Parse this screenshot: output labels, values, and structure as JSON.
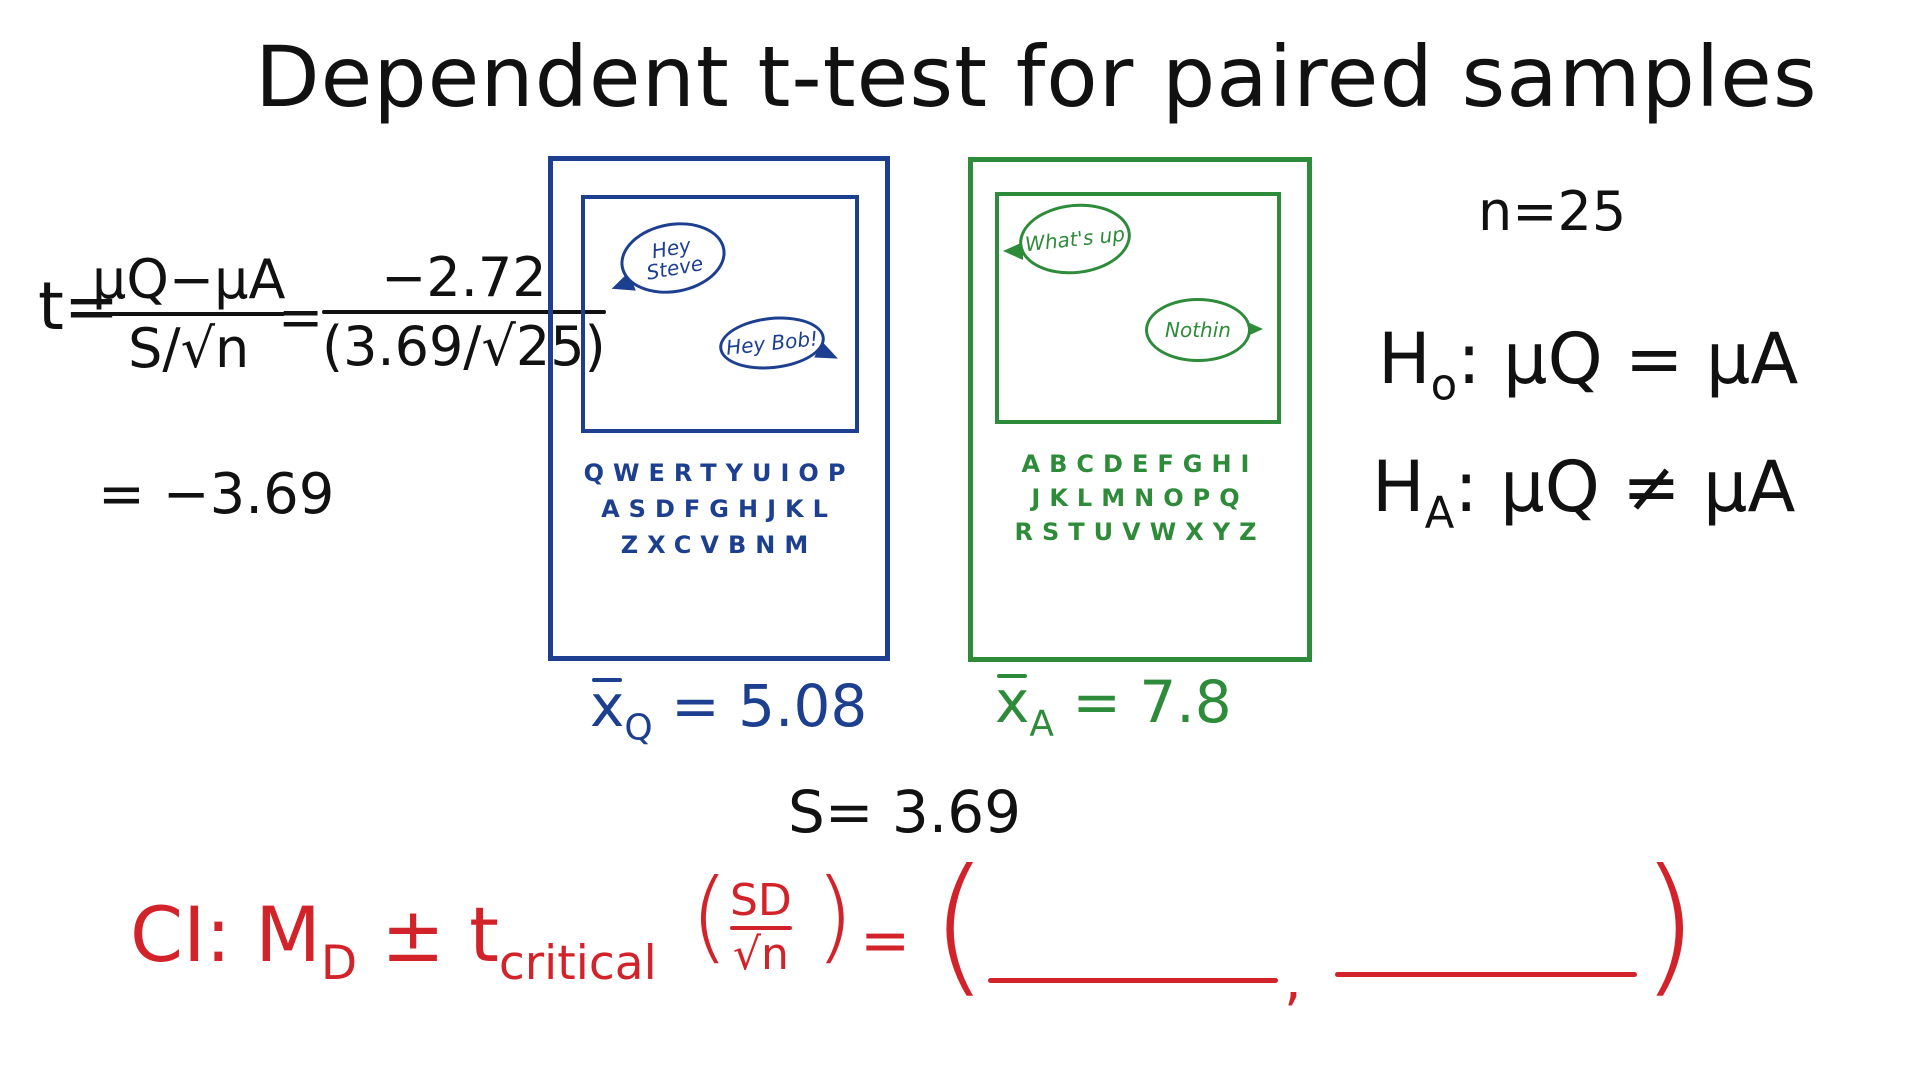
{
  "title": "Dependent t-test for paired samples",
  "formula": {
    "lhs": "t=",
    "frac1_num": "μQ−μA",
    "frac1_den": "S/√n",
    "eq": "=",
    "frac2_num": "−2.72",
    "frac2_den": "(3.69/√25)",
    "result": "= −3.69"
  },
  "phone_q": {
    "bubble1": "Hey Steve",
    "bubble2": "Hey Bob!",
    "keys_row1": "QWERTYUIOP",
    "keys_row2": "ASDFGHJKL",
    "keys_row3": "ZXCVBNM",
    "mean_label": "Q",
    "mean_value": "= 5.08"
  },
  "phone_a": {
    "bubble1": "What's up",
    "bubble2": "Nothin",
    "keys_row1": "ABCDEFGHI",
    "keys_row2": "JKLMNOPQ",
    "keys_row3": "RSTUVWXYZ",
    "mean_label": "A",
    "mean_value": "= 7.8"
  },
  "s_value": "S= 3.69",
  "n_value": "n=25",
  "hypotheses": {
    "h0_label": "H",
    "h0_sub": "o",
    "h0_expr": ": μQ = μA",
    "ha_label": "H",
    "ha_sub": "A",
    "ha_expr": ": μQ ≠ μA"
  },
  "ci": {
    "label": "CI:  M",
    "label_sub": "D",
    "pm": " ± t",
    "t_sub": "critical",
    "frac_num": "SD",
    "frac_den": "√n",
    "eq": "=",
    "comma": ","
  },
  "colors": {
    "ink": "#111111",
    "blue": "#1d3f8f",
    "green": "#2e8b3a",
    "red": "#d3232a"
  }
}
